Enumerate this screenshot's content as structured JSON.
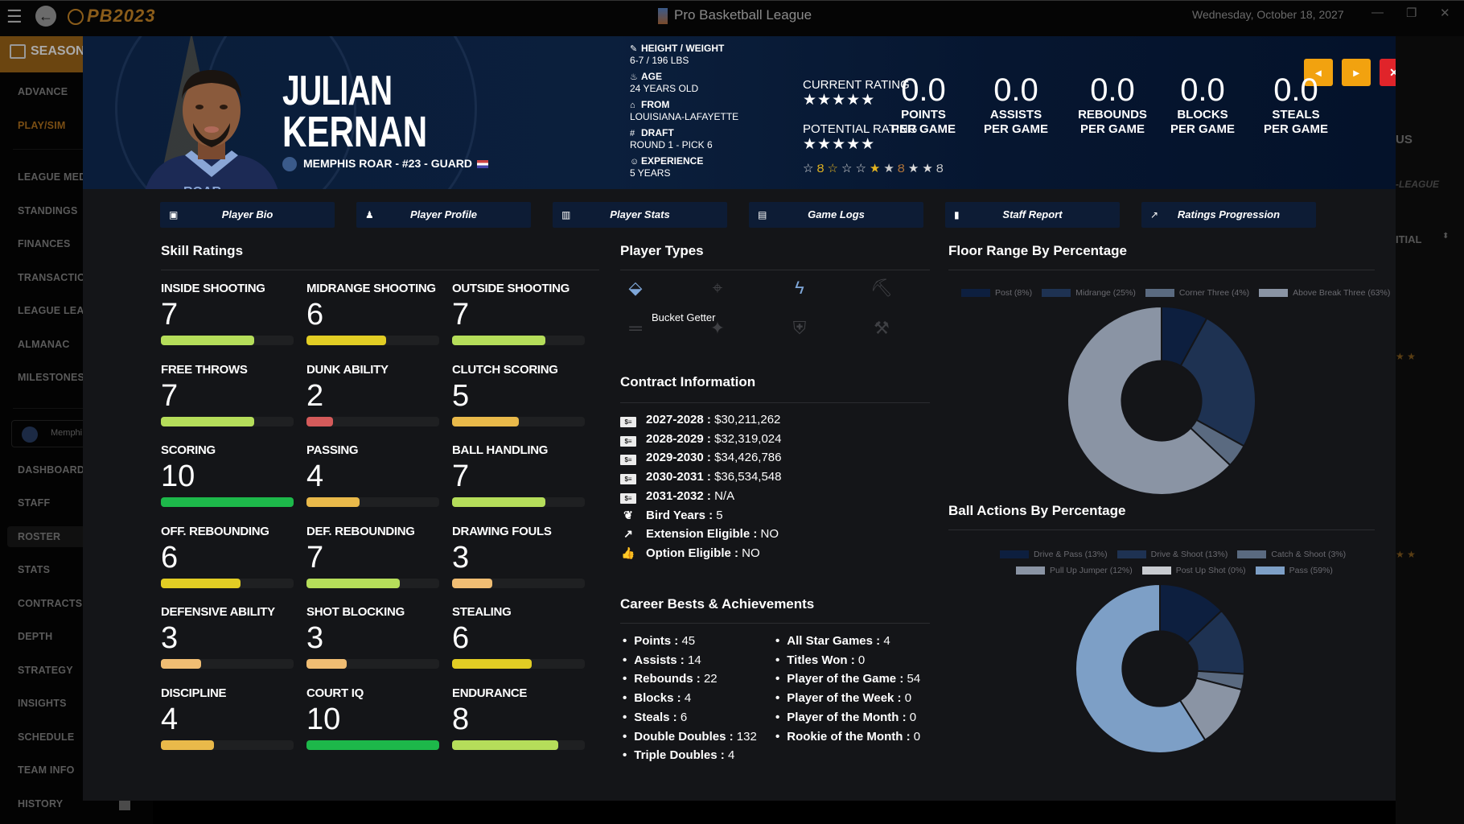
{
  "titlebar": {
    "logo": "PB2023",
    "title": "Pro Basketball League",
    "date": "Wednesday, October 18, 2027",
    "minimize": "—",
    "restore": "❐",
    "close": "✕"
  },
  "sidebar": {
    "season_label": "SEASON",
    "items_top": [
      "ADVANCE",
      "PLAY/SIM"
    ],
    "items_league": [
      "LEAGUE MED",
      "STANDINGS",
      "FINANCES",
      "TRANSACTIO",
      "LEAGUE LEAD",
      "ALMANAC",
      "MILESTONES"
    ],
    "team_chip": "Memphi",
    "items_team": [
      "DASHBOARD",
      "STAFF",
      "ROSTER",
      "STATS",
      "CONTRACTS",
      "DEPTH",
      "STRATEGY",
      "INSIGHTS",
      "SCHEDULE",
      "TEAM INFO",
      "HISTORY"
    ],
    "selected": "ROSTER",
    "active": "PLAY/SIM"
  },
  "background": {
    "us": "US",
    "league": "-LEAGUE",
    "itial": "ITIAL",
    "stars": "★ ★"
  },
  "player": {
    "first_name": "JULIAN",
    "last_name": "KERNAN",
    "team_line": "MEMPHIS ROAR - #23 - GUARD",
    "info": [
      {
        "icon": "ruler-icon",
        "glyph": "✎",
        "label": "HEIGHT / WEIGHT",
        "value": "6-7 / 196 LBS"
      },
      {
        "icon": "cake-icon",
        "glyph": "♨",
        "label": "AGE",
        "value": "24 YEARS OLD"
      },
      {
        "icon": "school-icon",
        "glyph": "⌂",
        "label": "FROM",
        "value": "LOUISIANA-LAFAYETTE"
      },
      {
        "icon": "hash-icon",
        "glyph": "#",
        "label": "DRAFT",
        "value": "ROUND 1 - PICK 6"
      },
      {
        "icon": "user-clock-icon",
        "glyph": "☺",
        "label": "EXPERIENCE",
        "value": "5 YEARS"
      }
    ],
    "current_rating_label": "CURRENT RATING",
    "current_rating_stars": 5,
    "potential_rating_label": "POTENTIAL RATING",
    "potential_rating_stars": 5,
    "badges": [
      "☆",
      "🏅",
      "☆",
      "☆",
      "☆",
      "★",
      "★",
      "🏅",
      "★",
      "★",
      "🏅"
    ],
    "per_game": [
      {
        "value": "0.0",
        "label1": "POINTS",
        "label2": "PER GAME"
      },
      {
        "value": "0.0",
        "label1": "ASSISTS",
        "label2": "PER GAME"
      },
      {
        "value": "0.0",
        "label1": "REBOUNDS",
        "label2": "PER GAME"
      },
      {
        "value": "0.0",
        "label1": "BLOCKS",
        "label2": "PER GAME"
      },
      {
        "value": "0.0",
        "label1": "STEALS",
        "label2": "PER GAME"
      }
    ]
  },
  "header_buttons": {
    "prev": "◂",
    "next": "▸",
    "close": "✕",
    "prev_color": "#f2a20f",
    "next_color": "#f2a20f",
    "close_color": "#e0242a"
  },
  "tabs": [
    {
      "label": "Player Bio",
      "icon": "▣"
    },
    {
      "label": "Player Profile",
      "icon": "♟"
    },
    {
      "label": "Player Stats",
      "icon": "▥"
    },
    {
      "label": "Game Logs",
      "icon": "▤"
    },
    {
      "label": "Staff Report",
      "icon": "▮"
    },
    {
      "label": "Ratings Progression",
      "icon": "↗"
    }
  ],
  "skills_title": "Skill Ratings",
  "skills": [
    {
      "name": "INSIDE SHOOTING",
      "value": "7",
      "pct": 70,
      "color": "#b5dd5a"
    },
    {
      "name": "MIDRANGE SHOOTING",
      "value": "6",
      "pct": 60,
      "color": "#e2cd24"
    },
    {
      "name": "OUTSIDE SHOOTING",
      "value": "7",
      "pct": 70,
      "color": "#b5dd5a"
    },
    {
      "name": "FREE THROWS",
      "value": "7",
      "pct": 70,
      "color": "#b5dd5a"
    },
    {
      "name": "DUNK ABILITY",
      "value": "2",
      "pct": 20,
      "color": "#d45a5a"
    },
    {
      "name": "CLUTCH SCORING",
      "value": "5",
      "pct": 50,
      "color": "#e9b94a"
    },
    {
      "name": "SCORING",
      "value": "10",
      "pct": 100,
      "color": "#1db84a"
    },
    {
      "name": "PASSING",
      "value": "4",
      "pct": 40,
      "color": "#e9b94a"
    },
    {
      "name": "BALL HANDLING",
      "value": "7",
      "pct": 70,
      "color": "#b5dd5a"
    },
    {
      "name": "OFF. REBOUNDING",
      "value": "6",
      "pct": 60,
      "color": "#e2cd24"
    },
    {
      "name": "DEF. REBOUNDING",
      "value": "7",
      "pct": 70,
      "color": "#b5dd5a"
    },
    {
      "name": "DRAWING FOULS",
      "value": "3",
      "pct": 30,
      "color": "#f0bd73"
    },
    {
      "name": "DEFENSIVE ABILITY",
      "value": "3",
      "pct": 30,
      "color": "#f0bd73"
    },
    {
      "name": "SHOT BLOCKING",
      "value": "3",
      "pct": 30,
      "color": "#f0bd73"
    },
    {
      "name": "STEALING",
      "value": "6",
      "pct": 60,
      "color": "#e2cd24"
    },
    {
      "name": "DISCIPLINE",
      "value": "4",
      "pct": 40,
      "color": "#e9b94a"
    },
    {
      "name": "COURT IQ",
      "value": "10",
      "pct": 100,
      "color": "#1db84a"
    },
    {
      "name": "ENDURANCE",
      "value": "8",
      "pct": 80,
      "color": "#b5dd5a"
    }
  ],
  "player_types": {
    "title": "Player Types",
    "tooltip": "Bucket Getter",
    "types": [
      {
        "icon": "bucket-icon",
        "glyph": "⬙",
        "active": true
      },
      {
        "icon": "crosshair-icon",
        "glyph": "⌖",
        "active": false
      },
      {
        "icon": "bolt-icon",
        "glyph": "ϟ",
        "active": true
      },
      {
        "icon": "paint-roller-icon",
        "glyph": "⛏",
        "active": false
      },
      {
        "icon": "equals-icon",
        "glyph": "═",
        "active": false
      },
      {
        "icon": "magic-wand-icon",
        "glyph": "✦",
        "active": false
      },
      {
        "icon": "shield-icon",
        "glyph": "⛨",
        "active": false
      },
      {
        "icon": "broom-icon",
        "glyph": "⚒",
        "active": false
      }
    ]
  },
  "contract": {
    "title": "Contract Information",
    "rows": [
      {
        "icon": "money-check-icon",
        "label": "2027-2028",
        "value": "$30,211,262"
      },
      {
        "icon": "money-check-icon",
        "label": "2028-2029",
        "value": "$32,319,024"
      },
      {
        "icon": "money-check-icon",
        "label": "2029-2030",
        "value": "$34,426,786"
      },
      {
        "icon": "money-check-icon",
        "label": "2030-2031",
        "value": "$36,534,548"
      },
      {
        "icon": "money-check-icon",
        "label": "2031-2032",
        "value": "N/A"
      },
      {
        "icon": "feather-icon",
        "label": "Bird Years",
        "value": "5"
      },
      {
        "icon": "external-link-icon",
        "label": "Extension Eligible",
        "value": "NO"
      },
      {
        "icon": "thumbs-up-icon",
        "label": "Option Eligible",
        "value": "NO"
      }
    ]
  },
  "career": {
    "title": "Career Bests & Achievements",
    "left": [
      {
        "label": "Points",
        "value": "45"
      },
      {
        "label": "Assists",
        "value": "14"
      },
      {
        "label": "Rebounds",
        "value": "22"
      },
      {
        "label": "Blocks",
        "value": "4"
      },
      {
        "label": "Steals",
        "value": "6"
      },
      {
        "label": "Double Doubles",
        "value": "132"
      },
      {
        "label": "Triple Doubles",
        "value": "4"
      }
    ],
    "right": [
      {
        "label": "All Star Games",
        "value": "4"
      },
      {
        "label": "Titles Won",
        "value": "0"
      },
      {
        "label": "Player of the Game",
        "value": "54"
      },
      {
        "label": "Player of the Week",
        "value": "0"
      },
      {
        "label": "Player of the Month",
        "value": "0"
      },
      {
        "label": "Rookie of the Month",
        "value": "0"
      }
    ]
  },
  "chart_data": [
    {
      "type": "pie",
      "title": "Floor Range By Percentage",
      "categories": [
        "Post",
        "Midrange",
        "Corner Three",
        "Above Break Three"
      ],
      "values": [
        8,
        25,
        4,
        63
      ],
      "legend_labels": [
        "Post (8%)",
        "Midrange (25%)",
        "Corner Three (4%)",
        "Above Break Three (63%)"
      ],
      "colors": [
        "#0d1f3f",
        "#1e3252",
        "#5a6a80",
        "#8a94a4"
      ],
      "legend": "top"
    },
    {
      "type": "pie",
      "title": "Ball Actions By Percentage",
      "categories": [
        "Drive & Pass",
        "Drive & Shoot",
        "Catch & Shoot",
        "Pull Up Jumper",
        "Post Up Shot",
        "Pass"
      ],
      "values": [
        13,
        13,
        3,
        12,
        0,
        59
      ],
      "legend_labels": [
        "Drive & Pass (13%)",
        "Drive & Shoot (13%)",
        "Catch & Shoot (3%)",
        "Pull Up Jumper (12%)",
        "Post Up Shot (0%)",
        "Pass (59%)"
      ],
      "colors": [
        "#0d1f3f",
        "#1e3252",
        "#5a6a80",
        "#8a94a4",
        "#c8cbd0",
        "#7d9fc6"
      ],
      "legend": "top"
    }
  ]
}
